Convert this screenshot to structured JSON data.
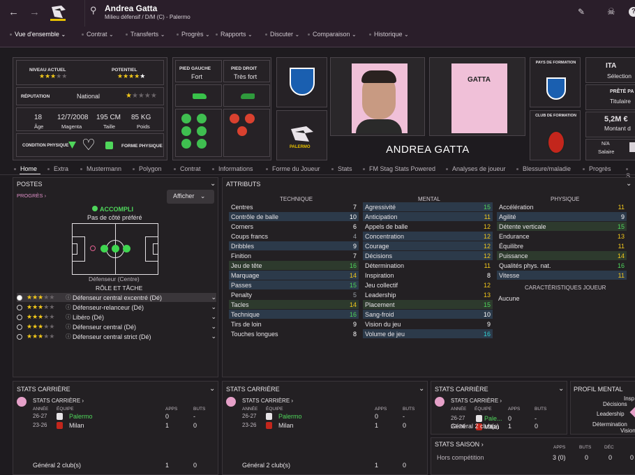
{
  "header": {
    "player_name": "Andrea Gatta",
    "subtitle": "Milieu défensif / D/M (C) - Palermo",
    "icons": [
      "back-arrow-icon",
      "forward-arrow-icon",
      "club-crest-icon",
      "search-icon",
      "edit-icon",
      "skull-icon",
      "help-icon"
    ]
  },
  "menu": [
    {
      "label": "Vue d'ensemble"
    },
    {
      "label": "Contrat"
    },
    {
      "label": "Transferts"
    },
    {
      "label": "Progrès"
    },
    {
      "label": "Rapports"
    },
    {
      "label": "Discuter"
    },
    {
      "label": "Comparaison"
    },
    {
      "label": "Historique"
    }
  ],
  "profile": {
    "niveau_label": "NIVEAU ACTUEL",
    "potentiel_label": "POTENTIEL",
    "reputation_label": "RÉPUTATION",
    "reputation_value": "National",
    "age": "18",
    "age_label": "Âge",
    "dob": "12/7/2008",
    "dob_label": "Magenta",
    "height": "195 CM",
    "height_label": "Taille",
    "weight": "85 KG",
    "weight_label": "Poids",
    "condition_label": "CONDITION PHYSIQUE",
    "forme_label": "FORME PHYSIQUE",
    "pied_gauche_label": "PIED GAUCHE",
    "pied_gauche": "Fort",
    "pied_droit_label": "PIED DROIT",
    "pied_droit": "Très fort",
    "shirt_name": "GATTA",
    "display_name": "ANDREA GATTA",
    "pays_label": "PAYS DE FORMATION",
    "club_label": "CLUB DE FORMATION",
    "club_crest_text": "PALERMO",
    "right_1_top": "ITA",
    "right_1_bottom": "Sélection",
    "right_2_top": "PRÊTÉ PA",
    "right_2_bottom": "Titulaire",
    "right_3_top": "5,2M €",
    "right_3_bottom": "Montant d",
    "right_4_top": "N/A",
    "right_4_bottom": "Salaire"
  },
  "tabs": [
    "Home",
    "Extra",
    "Mustermann",
    "Polygon",
    "Contrat",
    "Informations",
    "Forme du Joueur",
    "Stats",
    "FM Stag Stats Powered",
    "Analyses de joueur",
    "Blessure/maladie",
    "Progrès",
    "S"
  ],
  "postes": {
    "title": "POSTES",
    "progres": "PROGRÈS",
    "afficher": "Afficher",
    "accompli": "ACCOMPLI",
    "pied": "Pas de côté préféré",
    "position": "Défenseur (Centre)",
    "role_title": "RÔLE ET TÂCHE",
    "roles": [
      {
        "name": "Défenseur central excentré (Dé)",
        "stars": 2.5
      },
      {
        "name": "Défenseur-relanceur (Dé)",
        "stars": 2.5
      },
      {
        "name": "Libéro (Dé)",
        "stars": 2.5
      },
      {
        "name": "Défenseur central (Dé)",
        "stars": 2.5
      },
      {
        "name": "Défenseur central strict (Dé)",
        "stars": 2.5
      }
    ]
  },
  "attributes": {
    "title": "ATTRIBUTS",
    "technique_label": "TECHNIQUE",
    "mental_label": "MENTAL",
    "physique_label": "PHYSIQUE",
    "caracteristiques_label": "CARACTÉRISTIQUES JOUEUR",
    "caracteristiques_value": "Aucune",
    "technique": [
      {
        "n": "Centres",
        "v": "7",
        "c": "w",
        "h": 0
      },
      {
        "n": "Contrôle de balle",
        "v": "10",
        "c": "w",
        "h": 1
      },
      {
        "n": "Corners",
        "v": "6",
        "c": "w",
        "h": 0
      },
      {
        "n": "Coups francs",
        "v": "4",
        "c": "gr",
        "h": 0
      },
      {
        "n": "Dribbles",
        "v": "9",
        "c": "w",
        "h": 1
      },
      {
        "n": "Finition",
        "v": "7",
        "c": "w",
        "h": 0
      },
      {
        "n": "Jeu de tête",
        "v": "16",
        "c": "g",
        "h": 2
      },
      {
        "n": "Marquage",
        "v": "14",
        "c": "y",
        "h": 1
      },
      {
        "n": "Passes",
        "v": "15",
        "c": "g",
        "h": 1
      },
      {
        "n": "Penalty",
        "v": "5",
        "c": "gr",
        "h": 0
      },
      {
        "n": "Tacles",
        "v": "14",
        "c": "y",
        "h": 2
      },
      {
        "n": "Technique",
        "v": "16",
        "c": "g",
        "h": 1
      },
      {
        "n": "Tirs de loin",
        "v": "9",
        "c": "w",
        "h": 0
      },
      {
        "n": "Touches longues",
        "v": "8",
        "c": "w",
        "h": 0
      }
    ],
    "mental": [
      {
        "n": "Agressivité",
        "v": "15",
        "c": "g",
        "h": 1
      },
      {
        "n": "Anticipation",
        "v": "11",
        "c": "y",
        "h": 1
      },
      {
        "n": "Appels de balle",
        "v": "12",
        "c": "y",
        "h": 0
      },
      {
        "n": "Concentration",
        "v": "12",
        "c": "y",
        "h": 1
      },
      {
        "n": "Courage",
        "v": "12",
        "c": "y",
        "h": 1
      },
      {
        "n": "Décisions",
        "v": "12",
        "c": "y",
        "h": 1
      },
      {
        "n": "Détermination",
        "v": "11",
        "c": "y",
        "h": 0
      },
      {
        "n": "Inspiration",
        "v": "8",
        "c": "w",
        "h": 0
      },
      {
        "n": "Jeu collectif",
        "v": "12",
        "c": "y",
        "h": 0
      },
      {
        "n": "Leadership",
        "v": "13",
        "c": "y",
        "h": 0
      },
      {
        "n": "Placement",
        "v": "15",
        "c": "g",
        "h": 2
      },
      {
        "n": "Sang-froid",
        "v": "10",
        "c": "w",
        "h": 1
      },
      {
        "n": "Vision du jeu",
        "v": "9",
        "c": "w",
        "h": 0
      },
      {
        "n": "Volume de jeu",
        "v": "16",
        "c": "c",
        "h": 1
      }
    ],
    "physique": [
      {
        "n": "Accélération",
        "v": "11",
        "c": "y",
        "h": 0
      },
      {
        "n": "Agilité",
        "v": "9",
        "c": "w",
        "h": 1
      },
      {
        "n": "Détente verticale",
        "v": "15",
        "c": "g",
        "h": 2
      },
      {
        "n": "Endurance",
        "v": "13",
        "c": "y",
        "h": 0
      },
      {
        "n": "Équilibre",
        "v": "11",
        "c": "y",
        "h": 0
      },
      {
        "n": "Puissance",
        "v": "14",
        "c": "y",
        "h": 2
      },
      {
        "n": "Qualités phys. nat.",
        "v": "16",
        "c": "g",
        "h": 0
      },
      {
        "n": "Vitesse",
        "v": "11",
        "c": "y",
        "h": 1
      }
    ]
  },
  "career": {
    "title": "STATS CARRIÈRE",
    "sub": "STATS CARRIÈRE",
    "h_annee": "ANNÉE",
    "h_equipe": "ÉQUIPE",
    "h_apps": "APPS",
    "h_buts": "BUTS",
    "rows": [
      {
        "annee": "26-27",
        "equipe": "Palermo",
        "apps": "0",
        "buts": "-"
      },
      {
        "annee": "23-26",
        "equipe": "Milan",
        "apps": "1",
        "buts": "0"
      }
    ],
    "total_label": "Général 2 club(s)",
    "total_apps": "1",
    "total_buts": "0",
    "p3_row_team": "Pale...",
    "p3_total": "Général 2 club(s)"
  },
  "saison": {
    "title": "STATS SAISON",
    "h_apps": "APPS",
    "h_buts": "BUTS",
    "h_dec": "DÉC",
    "row_label": "Hors compétition",
    "apps": "3 (0)",
    "buts": "0",
    "dec": "0",
    "extra": "0"
  },
  "mental_profile": {
    "title": "PROFIL MENTAL",
    "labels": [
      "Insp",
      "Décisions",
      "Leadership",
      "Détermination",
      "Vision"
    ]
  }
}
